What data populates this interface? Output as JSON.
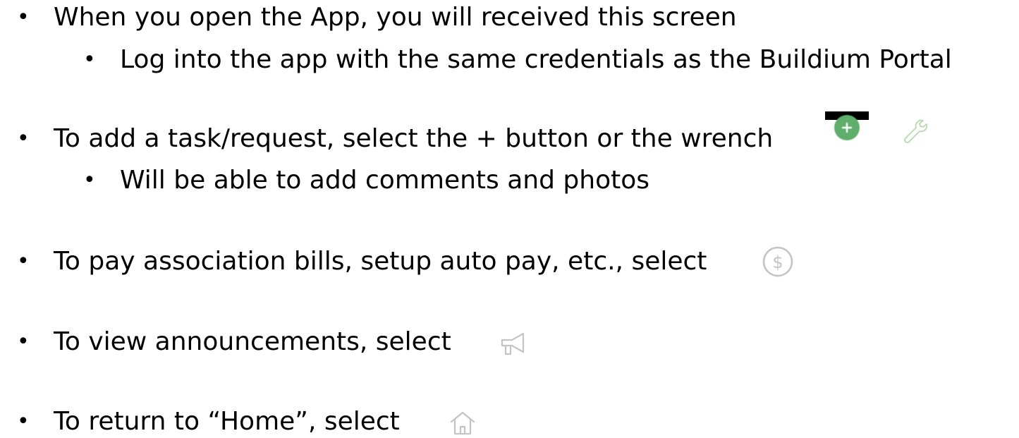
{
  "bullets": [
    {
      "level": 1,
      "text": "When you open the App, you will received this screen"
    },
    {
      "level": 2,
      "text": "Log into the app with the same credentials as the Buildium Portal"
    },
    {
      "level": 1,
      "text": "To add a task/request, select the + button or the wrench"
    },
    {
      "level": 2,
      "text": "Will be able to add comments and photos"
    },
    {
      "level": 1,
      "text": "To pay association bills, setup auto pay, etc., select"
    },
    {
      "level": 1,
      "text": "To view announcements, select"
    },
    {
      "level": 1,
      "text": "To return to “Home”, select"
    }
  ],
  "bullet_glyph": "•",
  "icons": {
    "add_button": {
      "name": "plus-icon",
      "glyph": "+",
      "color": "#5fae6b"
    },
    "wrench": {
      "name": "wrench-icon",
      "color": "#b8d8b0"
    },
    "payment": {
      "name": "dollar-circle-icon",
      "glyph": "$",
      "color": "#c4c4c4"
    },
    "announcements": {
      "name": "megaphone-icon",
      "color": "#c4c4c4"
    },
    "home": {
      "name": "home-icon",
      "color": "#c4c4c4"
    }
  }
}
